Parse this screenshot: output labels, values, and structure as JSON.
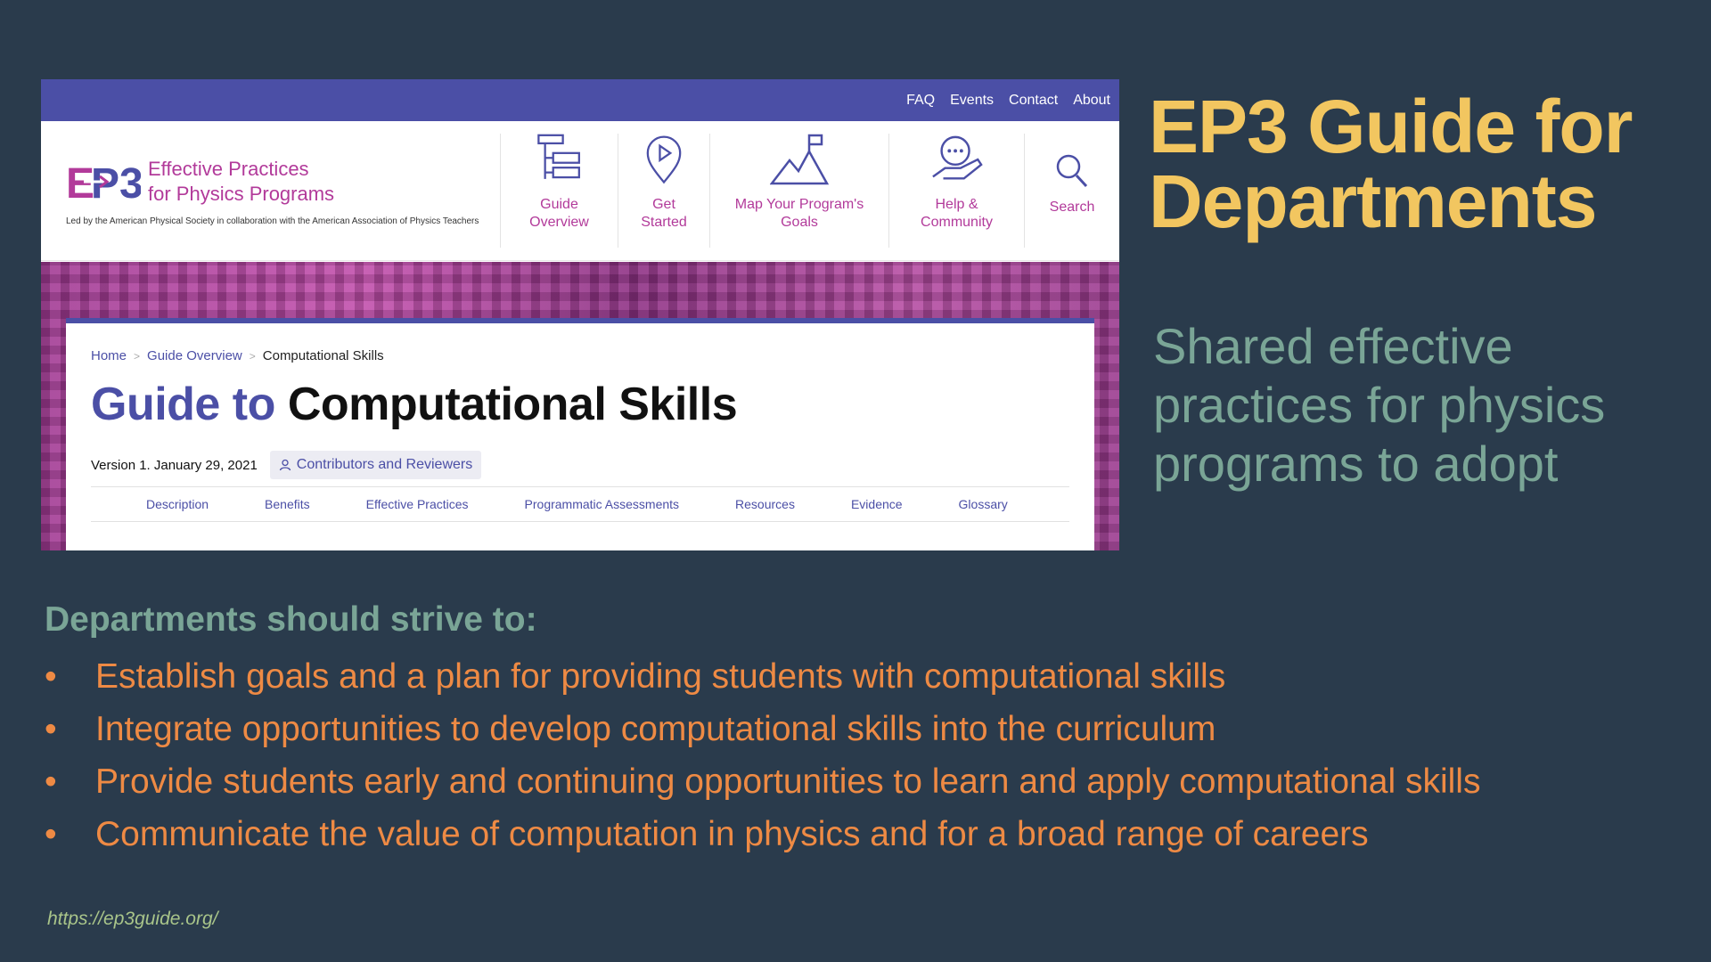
{
  "site": {
    "topnav": [
      "FAQ",
      "Events",
      "Contact",
      "About"
    ],
    "brand_line1": "Effective Practices",
    "brand_line2": "for Physics Programs",
    "brand_sub": "Led by the American Physical Society in collaboration with the American Association of Physics Teachers",
    "nav": {
      "guide": [
        "Guide",
        "Overview"
      ],
      "start": [
        "Get",
        "Started"
      ],
      "map": [
        "Map Your Program's",
        "Goals"
      ],
      "help": [
        "Help &",
        "Community"
      ],
      "search": "Search"
    },
    "breadcrumb": {
      "home": "Home",
      "guide": "Guide Overview",
      "current": "Computational Skills",
      "sep": ">"
    },
    "page_title_a": "Guide to",
    "page_title_b": "Computational Skills",
    "version": "Version 1. January 29, 2021",
    "contributors": "Contributors and Reviewers",
    "tabs": [
      "Description",
      "Benefits",
      "Effective Practices",
      "Programmatic Assessments",
      "Resources",
      "Evidence",
      "Glossary"
    ],
    "colors": {
      "primary": "#4b4fa6",
      "magenta": "#b23a9a"
    }
  },
  "slide": {
    "title_line1": "EP3 Guide for",
    "title_line2": "Departments",
    "subtitle": "Shared effective practices for physics programs to adopt",
    "strive_heading": "Departments should strive to:",
    "bullets": [
      "Establish goals and a plan for providing students with computational skills",
      "Integrate opportunities to develop computational skills into the curriculum",
      "Provide students early and continuing opportunities to learn and apply computational skills",
      "Communicate the value of computation in physics and for a broad range of careers"
    ],
    "url": "https://ep3guide.org/",
    "colors": {
      "background": "#2a3b4c",
      "title": "#f2c660",
      "accent_green": "#7aa596",
      "bullets": "#ee8a44"
    }
  }
}
